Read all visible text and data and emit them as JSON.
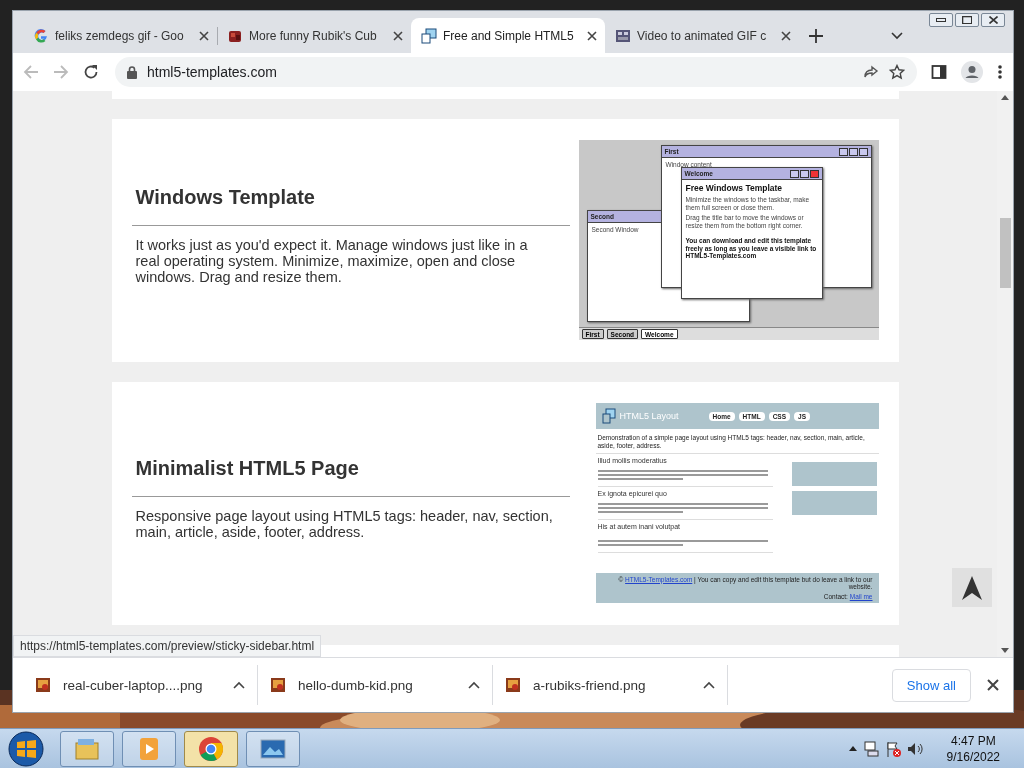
{
  "tabs": [
    {
      "kind": "google",
      "title": "feliks zemdegs gif - Goo",
      "selected": false
    },
    {
      "kind": "cube",
      "title": "More funny Rubik's Cub",
      "selected": false
    },
    {
      "kind": "template",
      "title": "Free and Simple HTML5",
      "selected": true
    },
    {
      "kind": "video",
      "title": "Video to animated GIF c",
      "selected": false
    }
  ],
  "address": "html5-templates.com",
  "templates": [
    {
      "title": "Windows Template",
      "description": "It works just as you'd expect it. Manage windows just like in a real operating system. Minimize, maximize, open and close windows. Drag and resize them.",
      "preview": {
        "kind": "windows",
        "windows": [
          {
            "title": "Second",
            "content": [
              {
                "kind": "plain",
                "text": "Second Window"
              }
            ]
          },
          {
            "title": "First",
            "active": false,
            "content": [
              {
                "kind": "plain",
                "text": "Window content"
              }
            ]
          },
          {
            "title": "Welcome",
            "active": true,
            "content": [
              {
                "kind": "heading",
                "text": "Free Windows Template"
              },
              {
                "kind": "plain",
                "text": "Minimize the windows to the taskbar, make them full screen or close them."
              },
              {
                "kind": "plain",
                "text": "Drag the title bar to move the windows or resize them from the bottom right corner."
              },
              {
                "kind": "bold",
                "text": "You can download and edit this template freely as long as you leave a visible link to HTML5-Templates.com"
              }
            ]
          }
        ],
        "taskbar": [
          "First",
          "Second",
          "Welcome"
        ]
      }
    },
    {
      "title": "Minimalist HTML5 Page",
      "description": "Responsive page layout using HTML5 tags: header, nav, section, main, article, aside, footer, address.",
      "preview": {
        "kind": "layout",
        "logo": "HTML5 Layout",
        "nav": [
          "Home",
          "HTML",
          "CSS",
          "JS"
        ],
        "intro": "Demonstration of a simple page layout using HTML5 tags: header, nav, section, main, article, aside, footer, address.",
        "articles": [
          "Illud mollis moderatius",
          "Ex ignota epicurei quo",
          "His at autem inani volutpat"
        ],
        "footer_prefix": "©",
        "footer_link": "HTML5-Templates.com",
        "footer_text": "| You can copy and edit this template but do leave a link to our website.",
        "contact_label": "Contact:",
        "contact_link": "Mail me"
      }
    }
  ],
  "status_url": "https://html5-templates.com/preview/sticky-sidebar.html",
  "downloads": [
    "real-cuber-laptop....png",
    "hello-dumb-kid.png",
    "a-rubiks-friend.png"
  ],
  "show_all": "Show all",
  "taskbar_apps": [
    {
      "kind": "explorer",
      "selected": false
    },
    {
      "kind": "media",
      "selected": false
    },
    {
      "kind": "chrome",
      "selected": true
    },
    {
      "kind": "photos",
      "selected": false
    }
  ],
  "clock": {
    "time": "4:47 PM",
    "date": "9/16/2022"
  }
}
